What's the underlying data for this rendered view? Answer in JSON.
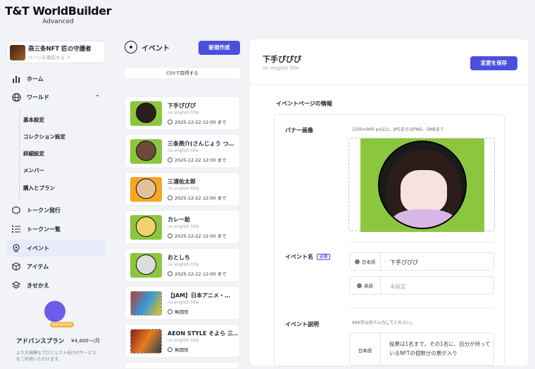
{
  "app": {
    "logo": "T&T WorldBuilder",
    "edition": "Advanced"
  },
  "project": {
    "name": "燕三条NFT 匠の守護者",
    "link": "ページを確認する"
  },
  "sidebar": {
    "items": [
      {
        "label": "ホーム",
        "icon": "bar-chart-icon"
      },
      {
        "label": "ワールド",
        "icon": "globe-icon"
      },
      {
        "label": "トークン発行",
        "icon": "hexagon-icon"
      },
      {
        "label": "トークン一覧",
        "icon": "list-icon"
      },
      {
        "label": "イベント",
        "icon": "pin-icon"
      },
      {
        "label": "アイテム",
        "icon": "cube-icon"
      },
      {
        "label": "きせかえ",
        "icon": "layers-icon"
      }
    ],
    "world_sub": [
      "基本設定",
      "コレクション設定",
      "詳細設定",
      "メンバー",
      "購入とプラン"
    ],
    "promo": {
      "badge": "Advanced",
      "title": "アドバンスプラン",
      "price": "¥4,400〜/月",
      "desc": "より大規模なプロジェクト向けのサービスをご利用いただけます。"
    }
  },
  "events": {
    "title": "イベント",
    "new_button": "新規作成",
    "csv_button": "CSVで取得する",
    "list": [
      {
        "name": "下手ぴぴぴ",
        "en": "no english title",
        "date": "2025-12-22 12:00 まで"
      },
      {
        "name": "三条燕介(さんじょう つ…",
        "en": "no english title",
        "date": "2025-12-22 12:00 まで"
      },
      {
        "name": "三浦佑太郎",
        "en": "no english title",
        "date": "2025-12-22 12:00 まで"
      },
      {
        "name": "カレー助",
        "en": "no english title",
        "date": "2025-12-22 12:00 まで"
      },
      {
        "name": "おとしち",
        "en": "no english title",
        "date": "2025-12-22 12:00 まで"
      },
      {
        "name": "【JAM】日本アニメ・…",
        "en": "no english title",
        "date": "無期限"
      },
      {
        "name": "AEON STYLE そよら 三…",
        "en": "no english title",
        "date": "無期限"
      }
    ]
  },
  "detail": {
    "title": "下手ぴぴぴ",
    "subtitle": "no english title",
    "save_button": "変更を保存",
    "section_title": "イベントページの情報",
    "banner_label": "バナー画像",
    "banner_hint": "1200×900 px以上、JPGまたはPNG、5MBまで",
    "name_label": "イベント名",
    "required": "必須",
    "name_ja_lang": "日本語",
    "name_ja_value": "下手ぴぴぴ",
    "name_en_lang": "英語",
    "name_en_placeholder": "未設定",
    "desc_label": "イベント説明",
    "desc_hint": "400字以内で入力してください。",
    "desc_lang": "日本語",
    "desc_value": "投票は1名まで。その1名に、自分が持っているNFTの個数分の票が入り"
  }
}
